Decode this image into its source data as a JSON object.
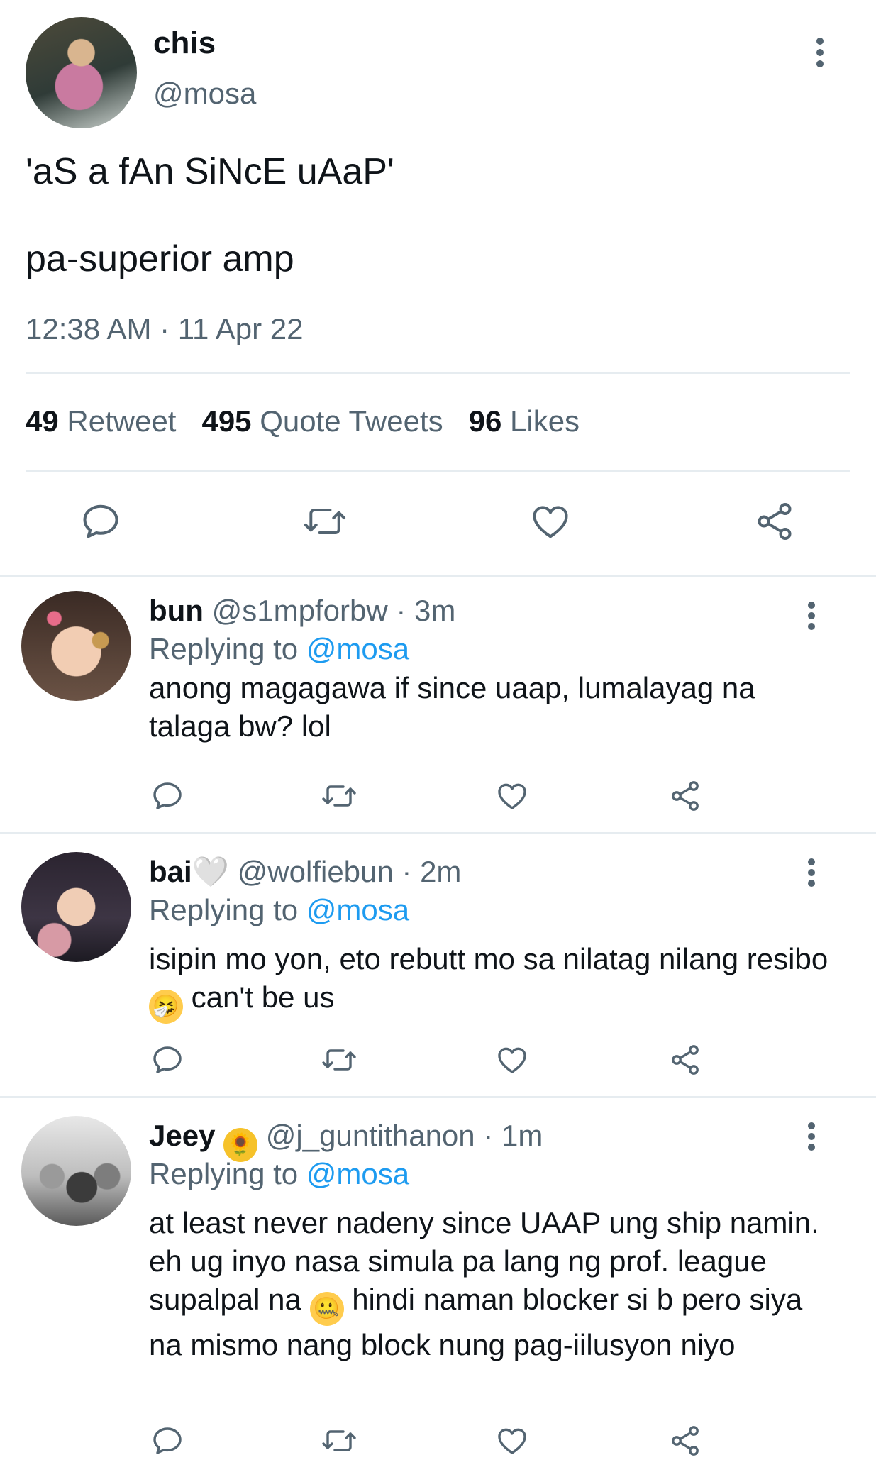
{
  "tweet": {
    "name": "chis",
    "handle": "@mosa",
    "text_line1": "'aS a fAn SiNcE uAaP'",
    "text_line2": "pa-superior amp",
    "time": "12:38 AM · 11 Apr 22",
    "stats": {
      "retweets": "49",
      "retweets_label": "Retweet",
      "quotes": "495",
      "quotes_label": "Quote Tweets",
      "likes": "96",
      "likes_label": "Likes"
    }
  },
  "replies": [
    {
      "name": "bun",
      "handle": "@s1mpforbw",
      "time": "· 3m",
      "replying_prefix": "Replying to",
      "replying_handle": "@mosa",
      "text": "anong magagawa if since uaap, lumalayag na talaga bw? lol"
    },
    {
      "name": "bai🤍",
      "handle": "@wolfiebun",
      "time": "· 2m",
      "replying_prefix": "Replying to",
      "replying_handle": "@mosa",
      "text_before_emoji": "isipin mo yon, eto rebutt mo sa nilatag nilang resibo",
      "emoji": "🤧",
      "text_after_emoji": "can't be us"
    },
    {
      "name": "Jeey",
      "name_emoji": "🌻",
      "handle": "@j_guntithanon",
      "time": "· 1m",
      "replying_prefix": "Replying to",
      "replying_handle": "@mosa",
      "text_before_emoji": "at least never nadeny since UAAP ung ship namin. eh ug inyo nasa simula pa lang ng prof. league supalpal na",
      "emoji": "🤐",
      "text_after_emoji": "hindi naman blocker si b pero siya na mismo nang block nung pag-iilusyon niyo"
    }
  ],
  "icons": {
    "reply": "comment-bubble-icon",
    "retweet": "retweet-arrows-icon",
    "like": "heart-outline-icon",
    "share": "share-nodes-icon",
    "more": "vertical-ellipsis-icon"
  },
  "colors": {
    "text": "#0f1419",
    "muted": "#536471",
    "link": "#1d9bf0",
    "divider": "#e6ecf0"
  }
}
